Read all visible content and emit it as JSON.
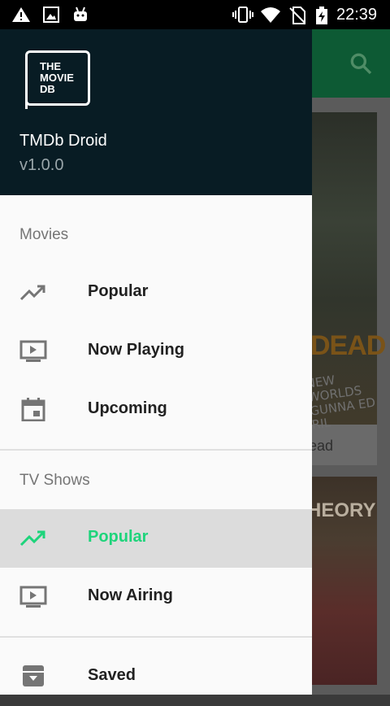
{
  "status_bar": {
    "time": "22:39",
    "left_icons": [
      "warning-icon",
      "image-icon",
      "android-icon"
    ],
    "right_icons": [
      "vibrate-icon",
      "wifi-icon",
      "no-sim-icon",
      "battery-charging-icon"
    ]
  },
  "drawer": {
    "logo_text": [
      "THE",
      "MOVIE",
      "DB"
    ],
    "app_name": "TMDb Droid",
    "version": "v1.0.0",
    "sections": [
      {
        "title": "Movies",
        "items": [
          {
            "label": "Popular",
            "icon": "trending-up-icon",
            "active": false
          },
          {
            "label": "Now Playing",
            "icon": "tv-play-icon",
            "active": false
          },
          {
            "label": "Upcoming",
            "icon": "calendar-icon",
            "active": false
          }
        ]
      },
      {
        "title": "TV Shows",
        "items": [
          {
            "label": "Popular",
            "icon": "trending-up-icon",
            "active": true
          },
          {
            "label": "Now Airing",
            "icon": "tv-play-icon",
            "active": false
          }
        ]
      },
      {
        "title": "",
        "items": [
          {
            "label": "Saved",
            "icon": "archive-icon",
            "active": false
          }
        ]
      }
    ]
  },
  "background": {
    "search_icon": "search-icon",
    "card_1_title": "ead",
    "poster_1_text": "DEAD",
    "poster_1_scrawl": "NEW WORLDS GUNNA ED RIL",
    "poster_2_text": "HEORY"
  },
  "colors": {
    "accent": "#1ed47b",
    "header_bg": "#081c24",
    "toolbar": "#0d5a34",
    "active_bg": "#dcdcdc"
  }
}
